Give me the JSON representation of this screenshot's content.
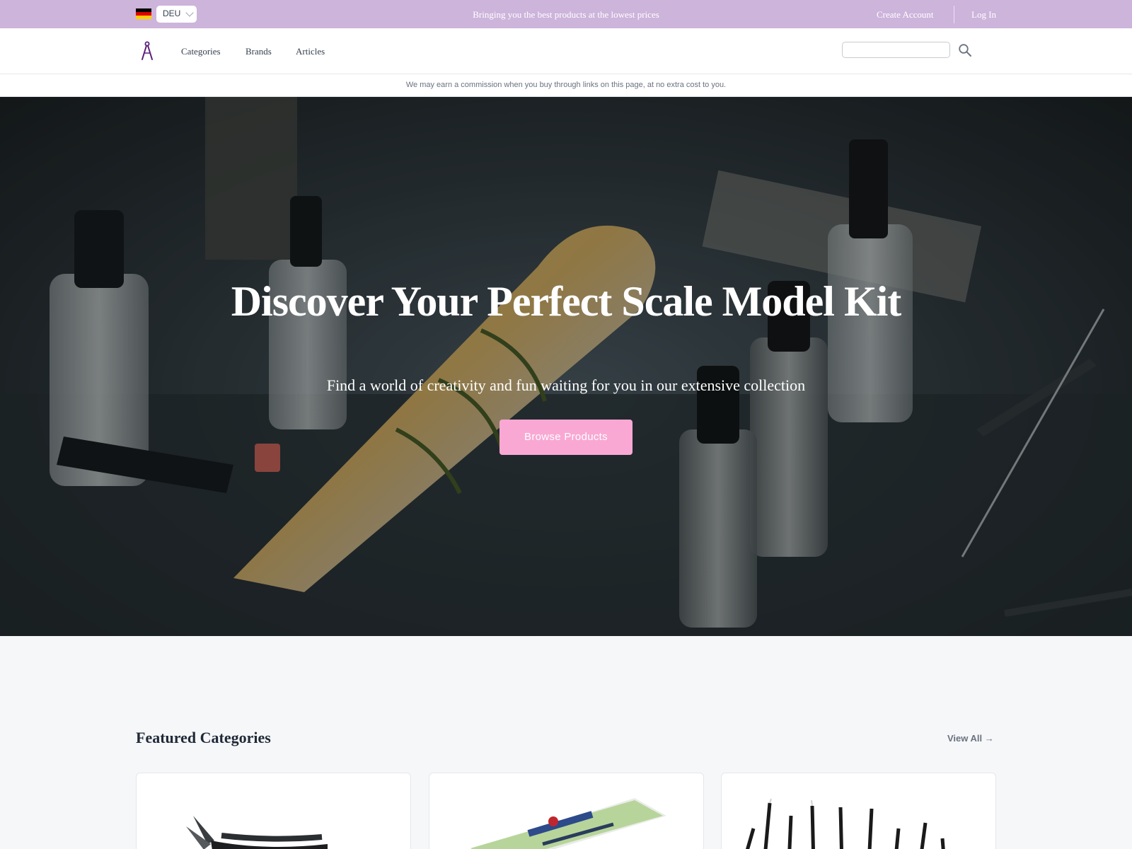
{
  "topbar": {
    "language": "DEU",
    "promo": "Bringing you the best products at the lowest prices",
    "create_account": "Create Account",
    "log_in": "Log In"
  },
  "nav": {
    "items": [
      "Categories",
      "Brands",
      "Articles"
    ],
    "search_placeholder": ""
  },
  "notice": "We may earn a commission when you buy through links on this page, at no extra cost to you.",
  "hero": {
    "title": "Discover Your Perfect Scale Model Kit",
    "subtitle": "Find a world of creativity and fun waiting for you in our extensive collection",
    "cta": "Browse Products"
  },
  "featured": {
    "title": "Featured Categories",
    "view_all": "View All →",
    "cards": [
      {
        "icon": "side-cutter-image"
      },
      {
        "icon": "epoxy-putty-image"
      },
      {
        "icon": "tweezers-image"
      }
    ]
  },
  "colors": {
    "topbar": "#cdb4db",
    "accent": "#f9a8d4",
    "logo": "#5b1f7a"
  }
}
